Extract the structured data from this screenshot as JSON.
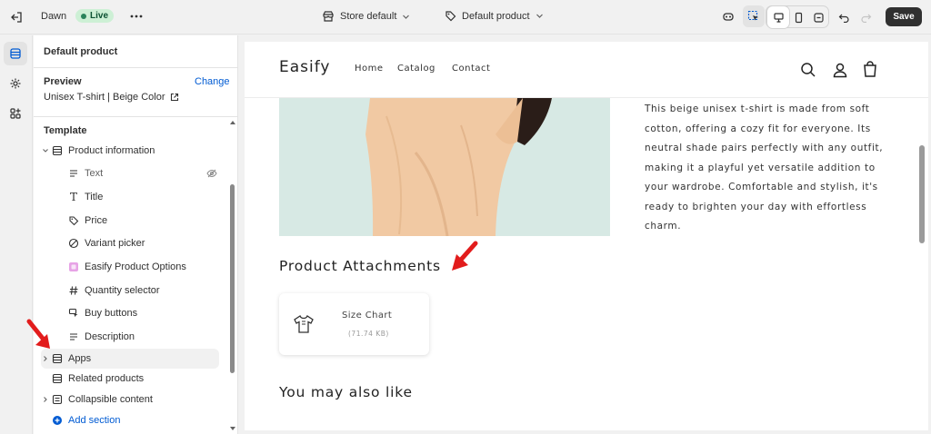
{
  "topbar": {
    "theme_name": "Dawn",
    "live_badge": "Live",
    "more_icon": "ellipsis-icon",
    "store_selector": "Store default",
    "template_selector": "Default product",
    "save_label": "Save"
  },
  "sidebar": {
    "title": "Default product",
    "preview_label": "Preview",
    "change_label": "Change",
    "preview_value": "Unisex T-shirt | Beige Color",
    "template_label": "Template",
    "tree": {
      "product_information": "Product information",
      "text": "Text",
      "title": "Title",
      "price": "Price",
      "variant_picker": "Variant picker",
      "easify_options": "Easify Product Options",
      "quantity_selector": "Quantity selector",
      "buy_buttons": "Buy buttons",
      "description": "Description",
      "apps": "Apps",
      "related_products": "Related products",
      "collapsible_content": "Collapsible content",
      "add_section": "Add section"
    }
  },
  "store": {
    "logo": "Easify",
    "nav": [
      "Home",
      "Catalog",
      "Contact"
    ],
    "description": "This beige unisex t-shirt is made from soft cotton, offering a cozy fit for everyone. Its neutral shade pairs perfectly with any outfit, making it a playful yet versatile addition to your wardrobe. Comfortable and stylish, it's ready to brighten your day with effortless charm.",
    "attachments_heading": "Product Attachments",
    "attachment_name": "Size Chart",
    "attachment_size": "(71.74 KB)",
    "also_like_heading": "You may also like"
  },
  "colors": {
    "accent_link": "#005bd3",
    "live_badge_bg": "#cdf0d5",
    "annotation_arrow": "#e21c1c",
    "product_bg": "#d7e9e4",
    "shirt": "#f1c9a3"
  }
}
